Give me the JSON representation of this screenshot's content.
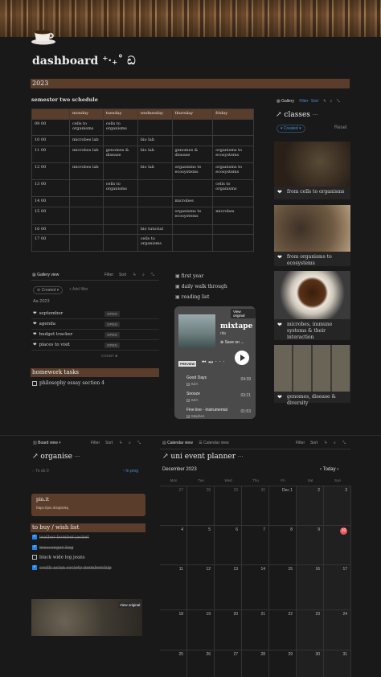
{
  "header": {
    "title": "dashboard ⁺‧₊˚ ඩ"
  },
  "year": "2023",
  "schedule": {
    "title": "semester two schedule",
    "days": [
      "monday",
      "tuesday",
      "wednesday",
      "thursday",
      "friday"
    ],
    "rows": [
      {
        "time": "09 00",
        "cells": [
          "cells to organisms",
          "cells to organisms",
          "",
          "",
          ""
        ]
      },
      {
        "time": "10 00",
        "cells": [
          "microbes lab",
          "",
          "bio lab",
          "",
          ""
        ]
      },
      {
        "time": "11 00",
        "cells": [
          "microbes lab",
          "genomes & disease",
          "bio lab",
          "genomes & disease",
          "organisms to ecosystems"
        ]
      },
      {
        "time": "12 00",
        "cells": [
          "microbes lab",
          "",
          "bio lab",
          "organisms to ecosystems",
          "organisms to ecosystems"
        ]
      },
      {
        "time": "13 00",
        "cells": [
          "",
          "cells to organisms",
          "",
          "",
          "cells to organisms"
        ]
      },
      {
        "time": "14 00",
        "cells": [
          "",
          "",
          "",
          "microbes",
          ""
        ]
      },
      {
        "time": "15 00",
        "cells": [
          "",
          "",
          "",
          "organisms to ecosystems",
          "microbes"
        ]
      },
      {
        "time": "16 00",
        "cells": [
          "",
          "",
          "bio tutorial",
          "",
          ""
        ]
      },
      {
        "time": "17 00",
        "cells": [
          "",
          "",
          "cells to organisms",
          "",
          ""
        ]
      }
    ]
  },
  "gallery": {
    "view": "Gallery",
    "filter": "Filter",
    "sort": "Sort",
    "title": "classes",
    "created": "Created",
    "reset": "Reset",
    "cards": [
      "from cells to organisms",
      "from organisms to ecosystems",
      "microbes, immune systems & their interaction",
      "genomes, disease & diversity"
    ]
  },
  "tasks_db": {
    "view": "Gallery view",
    "filter": "Filter",
    "sort": "Sort",
    "created": "Created",
    "add_filter": "+ Add filter",
    "group": "2023",
    "status": "OPEN",
    "items": [
      "september",
      "agenda",
      "budget tracker",
      "places to visit"
    ],
    "count_label": "COUNT",
    "count": "4"
  },
  "links": [
    "first year",
    "daily walk through",
    "reading list"
  ],
  "player": {
    "view_original": "View original",
    "title": "mixtape",
    "sub": "rita",
    "save": "Save on ...",
    "preview": "PREVIEW",
    "tracks": [
      {
        "name": "Good Days",
        "artist": "SZA",
        "time": "04:39"
      },
      {
        "name": "Snooze",
        "artist": "SZA",
        "time": "03:21"
      },
      {
        "name": "Fine line - Instrumental",
        "artist": "Stephen",
        "time": "01:53"
      }
    ]
  },
  "homework": {
    "title": "homework tasks",
    "items": [
      "philosophy essay section 4"
    ]
  },
  "board": {
    "view": "Board view",
    "filter": "Filter",
    "sort": "Sort",
    "title": "organise",
    "todo": "To do",
    "todo_count": "0",
    "in_prog": "In prog"
  },
  "pin": {
    "title": "pin.it",
    "url": "https://pin.it/4aj9z9q"
  },
  "wishlist": {
    "title": "to buy / wish list",
    "items": [
      {
        "text": "leather bomber jacket",
        "done": true
      },
      {
        "text": "messenger bag",
        "done": true
      },
      {
        "text": "black wide leg jeans",
        "done": false
      },
      {
        "text": "south asian society membership",
        "done": true
      }
    ]
  },
  "bottom_img": {
    "view_original": "View original"
  },
  "calendar": {
    "view1": "Calendar view",
    "view2": "Calendar view",
    "filter": "Filter",
    "sort": "Sort",
    "title": "uni event planner",
    "month": "December 2023",
    "today": "Today",
    "weekdays": [
      "Mon",
      "Tue",
      "Wed",
      "Thu",
      "Fri",
      "Sat",
      "Sun"
    ],
    "weeks": [
      [
        "27",
        "28",
        "29",
        "30",
        "Dec 1",
        "2",
        "3"
      ],
      [
        "4",
        "5",
        "6",
        "7",
        "8",
        "9",
        "10"
      ],
      [
        "11",
        "12",
        "13",
        "14",
        "15",
        "16",
        "17"
      ],
      [
        "18",
        "19",
        "20",
        "21",
        "22",
        "23",
        "24"
      ],
      [
        "25",
        "26",
        "27",
        "28",
        "29",
        "30",
        "31"
      ]
    ],
    "today_date": "10"
  },
  "colors": {
    "accent_brown": "#5a3d2b",
    "blue": "#2383e2",
    "today_red": "#eb5757"
  }
}
